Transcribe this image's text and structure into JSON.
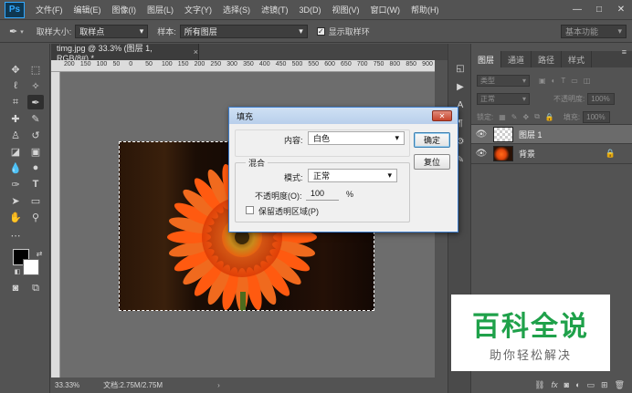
{
  "app": {
    "logo": "Ps",
    "menus": [
      "文件(F)",
      "编辑(E)",
      "图像(I)",
      "图层(L)",
      "文字(Y)",
      "选择(S)",
      "滤镜(T)",
      "3D(D)",
      "视图(V)",
      "窗口(W)",
      "帮助(H)"
    ],
    "window_controls": [
      "—",
      "□",
      "✕"
    ]
  },
  "options": {
    "sample_size_label": "取样大小:",
    "sample_size_value": "取样点",
    "sample_label": "样本:",
    "sample_value": "所有图层",
    "show_ring_label": "显示取样环",
    "workspace": "基本功能"
  },
  "document": {
    "tab_title": "timg.jpg @ 33.3% (图层 1, RGB/8#) *",
    "tab_close": "×",
    "ruler_ticks": [
      "200",
      "150",
      "100",
      "50",
      "0",
      "50",
      "100",
      "150",
      "200",
      "250",
      "300",
      "350",
      "400",
      "450",
      "500",
      "550",
      "600",
      "650",
      "700",
      "750",
      "800",
      "850",
      "900"
    ],
    "zoom": "33.33%",
    "doc_info": "文档:2.75M/2.75M"
  },
  "layers_panel": {
    "tabs": [
      "图层",
      "通道",
      "路径",
      "样式"
    ],
    "menu": "≡",
    "kind_filter": "类型",
    "blend_mode": "正常",
    "opacity_label": "不透明度:",
    "opacity_value": "100%",
    "lock_label": "锁定:",
    "fill_label": "填充:",
    "fill_value": "100%",
    "layers": [
      {
        "name": "图层 1",
        "selected": true,
        "locked": false
      },
      {
        "name": "背景",
        "selected": false,
        "locked": true
      }
    ],
    "footer_icons": [
      "link-icon",
      "fx-icon",
      "mask-icon",
      "adjustment-icon",
      "folder-icon",
      "new-layer-icon",
      "trash-icon"
    ]
  },
  "fill_dialog": {
    "title": "填充",
    "close": "✕",
    "content_label": "内容:",
    "content_value": "白色",
    "blend_group_label": "混合",
    "mode_label": "模式:",
    "mode_value": "正常",
    "opacity_label": "不透明度(O):",
    "opacity_value": "100",
    "opacity_unit": "%",
    "preserve_label": "保留透明区域(P)",
    "ok_label": "确定",
    "reset_label": "复位"
  },
  "watermark": {
    "title": "百科全说",
    "subtitle": "助你轻松解决"
  },
  "colors": {
    "ui_bg": "#535353",
    "canvas_bg": "#6d6d6d",
    "accent": "#31a8ff",
    "watermark_green": "#1fa14a"
  }
}
